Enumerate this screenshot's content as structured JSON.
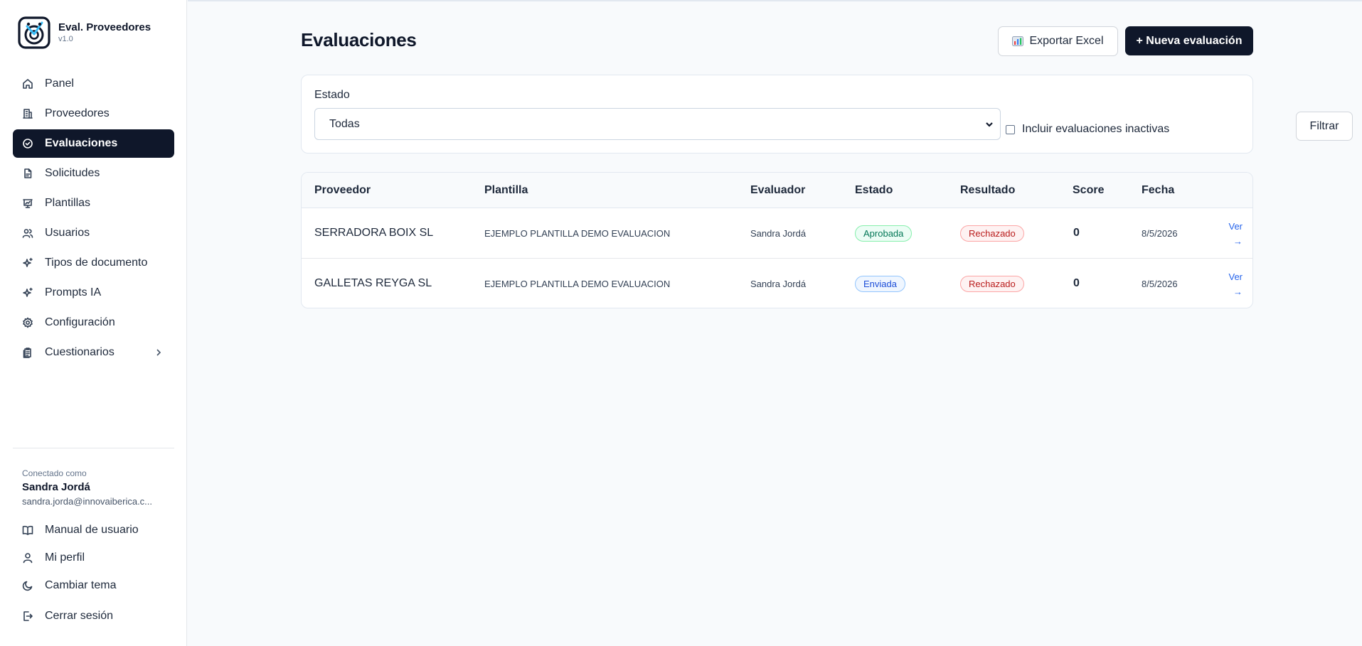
{
  "sidebar": {
    "brand": {
      "name": "Eval. Proveedores",
      "version": "v1.0"
    },
    "items": [
      {
        "label": "Panel",
        "icon": "home-icon"
      },
      {
        "label": "Proveedores",
        "icon": "building-icon"
      },
      {
        "label": "Evaluaciones",
        "icon": "check-circle-icon",
        "active": true
      },
      {
        "label": "Solicitudes",
        "icon": "file-icon"
      },
      {
        "label": "Plantillas",
        "icon": "presentation-icon"
      },
      {
        "label": "Usuarios",
        "icon": "users-icon"
      },
      {
        "label": "Tipos de documento",
        "icon": "sparkles-icon"
      },
      {
        "label": "Prompts IA",
        "icon": "sparkles-icon"
      },
      {
        "label": "Configuración",
        "icon": "gear-icon"
      },
      {
        "label": "Cuestionarios",
        "icon": "clipboard-icon"
      }
    ],
    "user": {
      "caption": "Conectado como",
      "name": "Sandra Jordá",
      "email": "sandra.jorda@innovaiberica.c..."
    },
    "bottom": [
      {
        "label": "Manual de usuario",
        "icon": "book-icon"
      },
      {
        "label": "Mi perfil",
        "icon": "user-icon"
      },
      {
        "label": "Cambiar tema",
        "icon": "moon-icon"
      },
      {
        "label": "Cerrar sesión",
        "icon": "logout-icon"
      }
    ]
  },
  "header": {
    "title": "Evaluaciones",
    "export_label": "Exportar Excel",
    "new_label": "+ Nueva evaluación"
  },
  "filters": {
    "estado_label": "Estado",
    "estado_value": "Todas",
    "inactive_label": "Incluir evaluaciones inactivas",
    "filter_button": "Filtrar"
  },
  "table": {
    "columns": [
      "Proveedor",
      "Plantilla",
      "Evaluador",
      "Estado",
      "Resultado",
      "Score",
      "Fecha"
    ],
    "rows": [
      {
        "proveedor": "SERRADORA BOIX SL",
        "plantilla": "EJEMPLO PLANTILLA DEMO EVALUACION",
        "evaluador": "Sandra Jordá",
        "estado": "Aprobada",
        "resultado": "Rechazado",
        "score": "0",
        "fecha": "8/5/2026",
        "action_1": "Ver",
        "action_2": "→"
      },
      {
        "proveedor": "GALLETAS REYGA SL",
        "plantilla": "EJEMPLO PLANTILLA DEMO EVALUACION",
        "evaluador": "Sandra Jordá",
        "estado": "Enviada",
        "resultado": "Rechazado",
        "score": "0",
        "fecha": "8/5/2026",
        "action_1": "Ver",
        "action_2": "→"
      }
    ]
  },
  "colors": {
    "primary": "#0f172a",
    "approved": "#047857",
    "sent": "#1d4ed8",
    "rejected": "#b91c1c",
    "link": "#2563eb"
  }
}
